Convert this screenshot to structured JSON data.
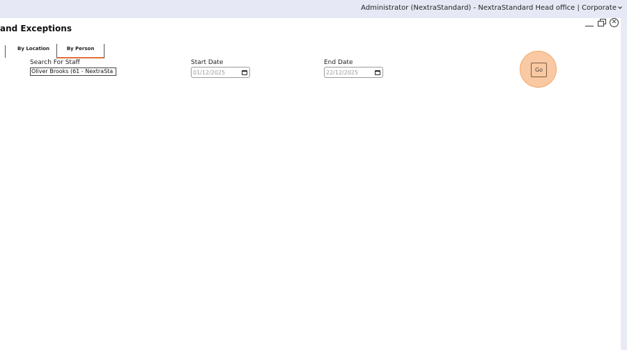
{
  "header": {
    "user_context": "Administrator (NextraStandard) - NextraStandard Head office | Corporate"
  },
  "page": {
    "title": "and Exceptions"
  },
  "window_controls": {
    "minimize_icon": "minimize-icon",
    "restore_icon": "restore-icon",
    "close_icon": "close-icon",
    "close_glyph": "✕"
  },
  "tabs": [
    {
      "label": "By Location",
      "active": false
    },
    {
      "label": "By Person",
      "active": true
    }
  ],
  "form": {
    "staff_label": "Search For Staff",
    "staff_value": "Oliver Brooks (61 - NextraSta",
    "start_label": "Start Date",
    "start_value": "01/12/2025",
    "end_label": "End Date",
    "end_value": "22/12/2025",
    "go_label": "Go"
  },
  "colors": {
    "active_tab_underline": "#e0703a",
    "go_highlight": "#f9c9a3",
    "topbar_bg": "#e6e9f5"
  }
}
